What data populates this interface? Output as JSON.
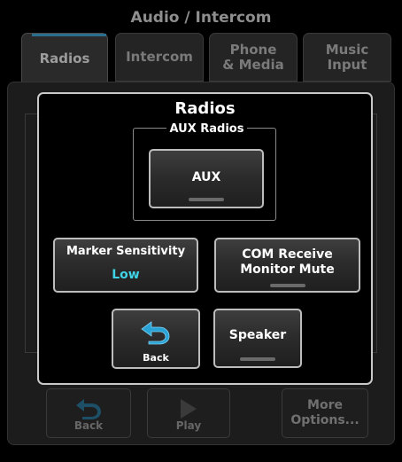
{
  "header": {
    "title": "Audio / Intercom"
  },
  "tabs": [
    {
      "label": "Radios",
      "active": true
    },
    {
      "label": "Intercom",
      "active": false
    },
    {
      "label": "Phone\n& Media",
      "active": false
    },
    {
      "label": "Music\nInput",
      "active": false
    }
  ],
  "bottom_bar": {
    "back_label": "Back",
    "back_icon": "back-arrow-icon",
    "play_label": "Play",
    "play_icon": "play-icon",
    "more_label": "More\nOptions..."
  },
  "modal": {
    "title": "Radios",
    "group_label": "AUX Radios",
    "aux_button": {
      "label": "AUX",
      "indicator_on": false
    },
    "marker_button": {
      "label": "Marker Sensitivity",
      "value": "Low"
    },
    "com_button": {
      "label": "COM Receive\nMonitor Mute",
      "indicator_on": false
    },
    "back_button": {
      "label": "Back",
      "icon": "back-arrow-icon"
    },
    "speaker_button": {
      "label": "Speaker",
      "indicator_on": false
    }
  },
  "colors": {
    "value_cyan": "#3fd3e6",
    "back_arrow_blue": "#29a3d6",
    "modal_border": "#c9c9c9"
  }
}
